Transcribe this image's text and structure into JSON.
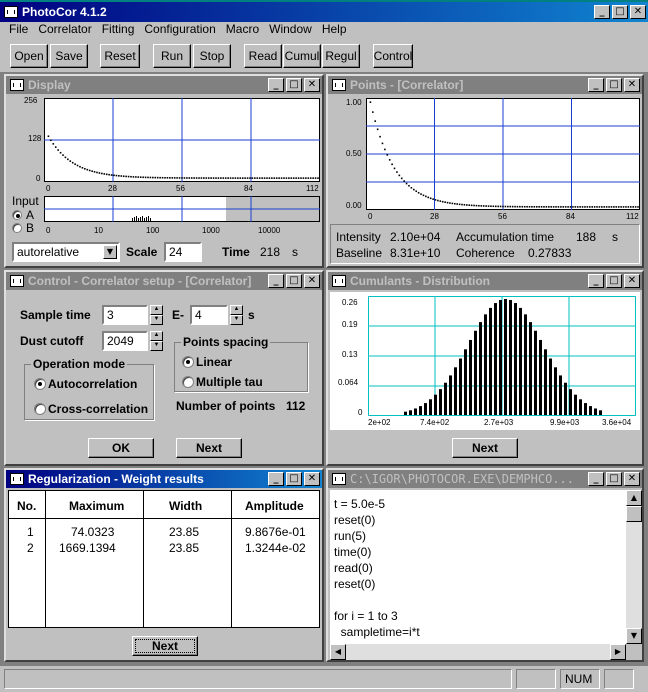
{
  "app": {
    "title": "PhotoCor 4.1.2"
  },
  "menu": [
    "File",
    "Correlator",
    "Fitting",
    "Configuration",
    "Macro",
    "Window",
    "Help"
  ],
  "toolbar": {
    "open": "Open",
    "save": "Save",
    "reset": "Reset",
    "run": "Run",
    "stop": "Stop",
    "read": "Read",
    "cumul": "Cumul",
    "regul": "Regul",
    "control": "Control"
  },
  "display": {
    "title": "Display",
    "y_ticks": [
      "256",
      "128",
      "0"
    ],
    "x_ticks": [
      "0",
      "28",
      "56",
      "84",
      "112"
    ],
    "input_label": "Input",
    "input_a": "A",
    "input_b": "B",
    "b_ticks": [
      "0",
      "10",
      "100",
      "1000",
      "10000"
    ],
    "mode": "autorelative",
    "scale_label": "Scale",
    "scale_value": "24",
    "time_label": "Time",
    "time_value": "218",
    "time_unit": "s"
  },
  "points": {
    "title": "Points - [Correlator]",
    "y_ticks": [
      "1.00",
      "0.50",
      "0.00"
    ],
    "x_ticks": [
      "0",
      "28",
      "56",
      "84",
      "112"
    ],
    "intensity_label": "Intensity",
    "intensity_value": "2.10e+04",
    "acc_label": "Accumulation time",
    "acc_value": "188",
    "acc_unit": "s",
    "baseline_label": "Baseline",
    "baseline_value": "8.31e+10",
    "coherence_label": "Coherence",
    "coherence_value": "0.27833"
  },
  "control": {
    "title": "Control - Correlator setup - [Correlator]",
    "sample_label": "Sample time",
    "sample_value": "3",
    "e_label": "E-",
    "e_value": "4",
    "e_unit": "s",
    "dust_label": "Dust cutoff",
    "dust_value": "2049",
    "opmode_title": "Operation mode",
    "auto": "Autocorrelation",
    "cross": "Cross-correlation",
    "spacing_title": "Points spacing",
    "linear": "Linear",
    "multiple": "Multiple tau",
    "npoints_label": "Number of points",
    "npoints_value": "112",
    "ok": "OK",
    "next": "Next"
  },
  "cumulants": {
    "title": "Cumulants - Distribution",
    "y_ticks": [
      "0.26",
      "0.19",
      "0.13",
      "0.064",
      "0"
    ],
    "x_ticks": [
      "2e+02",
      "7.4e+02",
      "2.7e+03",
      "9.9e+03",
      "3.6e+04"
    ],
    "next": "Next"
  },
  "regularization": {
    "title": "Regularization - Weight results",
    "headers": [
      "No.",
      "Maximum",
      "Width",
      "Amplitude"
    ],
    "rows": [
      [
        "1",
        "74.0323",
        "23.85",
        "9.8676e-01"
      ],
      [
        "2",
        "1669.1394",
        "23.85",
        "1.3244e-02"
      ]
    ],
    "next": "Next"
  },
  "macro": {
    "title": "C:\\IGOR\\PHOTOCOR.EXE\\DEMPHCO...",
    "lines": [
      "t = 5.0e-5",
      "reset(0)",
      "run(5)",
      "time(0)",
      "read(0)",
      "reset(0)",
      "",
      "for i = 1 to 3",
      "  sampletime=i*t"
    ]
  },
  "status": {
    "num": "NUM"
  },
  "chart_data": [
    {
      "type": "scatter",
      "title": "Display",
      "x_range": [
        0,
        112
      ],
      "y_range": [
        0,
        256
      ],
      "decay_from": 140,
      "decay_to": 6
    },
    {
      "type": "scatter",
      "title": "Points - [Correlator]",
      "x_range": [
        0,
        112
      ],
      "y_range": [
        0,
        1
      ],
      "decay_from": 0.98,
      "decay_to": 0.01
    },
    {
      "type": "bar",
      "title": "Cumulants - Distribution",
      "categories": [
        "2e+02",
        "7.4e+02",
        "2.7e+03",
        "9.9e+03",
        "3.6e+04"
      ],
      "bar_count": 40,
      "peak": 0.26,
      "y_range": [
        0,
        0.26
      ]
    }
  ]
}
